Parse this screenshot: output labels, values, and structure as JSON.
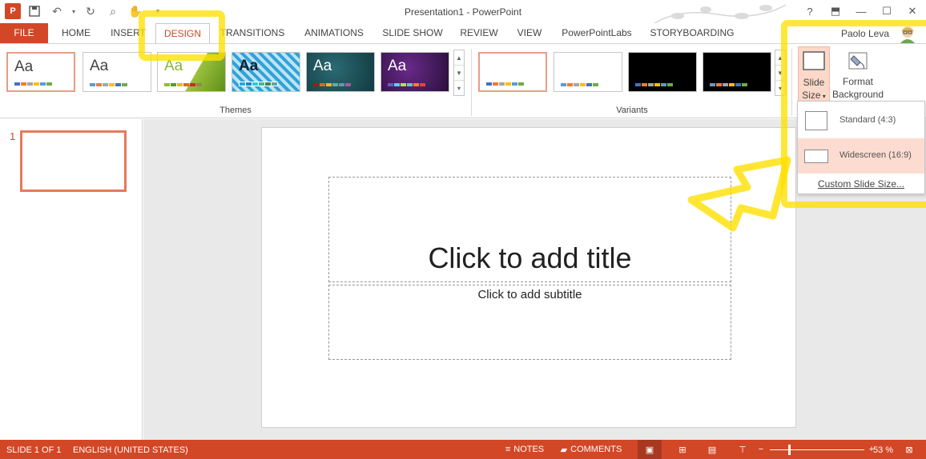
{
  "app": {
    "title": "Presentation1 - PowerPoint",
    "logo_letter": "P",
    "user_name": "Paolo Leva",
    "help": "?"
  },
  "tabs": [
    "FILE",
    "HOME",
    "INSERT",
    "DESIGN",
    "TRANSITIONS",
    "ANIMATIONS",
    "SLIDE SHOW",
    "REVIEW",
    "VIEW",
    "PowerPointLabs",
    "STORYBOARDING"
  ],
  "active_tab": "DESIGN",
  "ribbon": {
    "themes_label": "Themes",
    "variants_label": "Variants",
    "theme_sample_text": "Aa",
    "slide_size_label": "Slide",
    "slide_size_label2": "Size",
    "format_background_label": "Format",
    "format_background_label2": "Background"
  },
  "slide_size_menu": {
    "items": [
      "Standard (4:3)",
      "Widescreen (16:9)"
    ],
    "highlighted": "Widescreen (16:9)",
    "custom": "Custom Slide Size..."
  },
  "thumbnails": {
    "number": "1"
  },
  "slide": {
    "title_placeholder": "Click to add title",
    "subtitle_placeholder": "Click to add subtitle"
  },
  "status": {
    "slide_indicator": "SLIDE 1 OF 1",
    "language": "ENGLISH (UNITED STATES)",
    "notes": "NOTES",
    "comments": "COMMENTS",
    "zoom": "53 %"
  },
  "colors": {
    "accent": "#d24726",
    "highlight": "#ffe000"
  }
}
